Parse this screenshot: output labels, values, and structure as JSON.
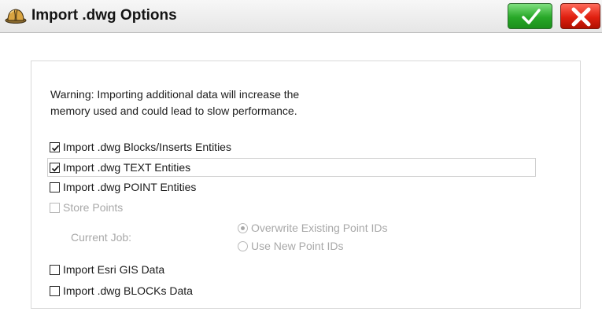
{
  "window": {
    "title": "Import .dwg Options",
    "icon": "hard-hat-icon",
    "ok_icon": "checkmark-icon",
    "cancel_icon": "close-x-icon"
  },
  "warning_text": "Warning: Importing additional data will increase the memory used and could lead to slow performance.",
  "options": {
    "blocks_inserts": {
      "label": "Import .dwg Blocks/Inserts Entities",
      "checked": true
    },
    "text_entities": {
      "label": "Import .dwg TEXT Entities",
      "checked": true
    },
    "point_entities": {
      "label": "Import .dwg POINT Entities",
      "checked": false
    },
    "store_points": {
      "label": "Store Points",
      "checked": false,
      "enabled": false
    },
    "esri_gis": {
      "label": "Import Esri GIS Data",
      "checked": false
    },
    "blocks_data": {
      "label": "Import .dwg BLOCKs Data",
      "checked": false
    }
  },
  "current_job": {
    "label": "Current Job:",
    "overwrite": {
      "label": "Overwrite Existing Point IDs",
      "selected": true
    },
    "use_new": {
      "label": "Use New Point IDs",
      "selected": false
    }
  },
  "colors": {
    "ok_green": "#28a828",
    "cancel_red": "#e02010",
    "disabled_text": "#a8a8a8"
  }
}
